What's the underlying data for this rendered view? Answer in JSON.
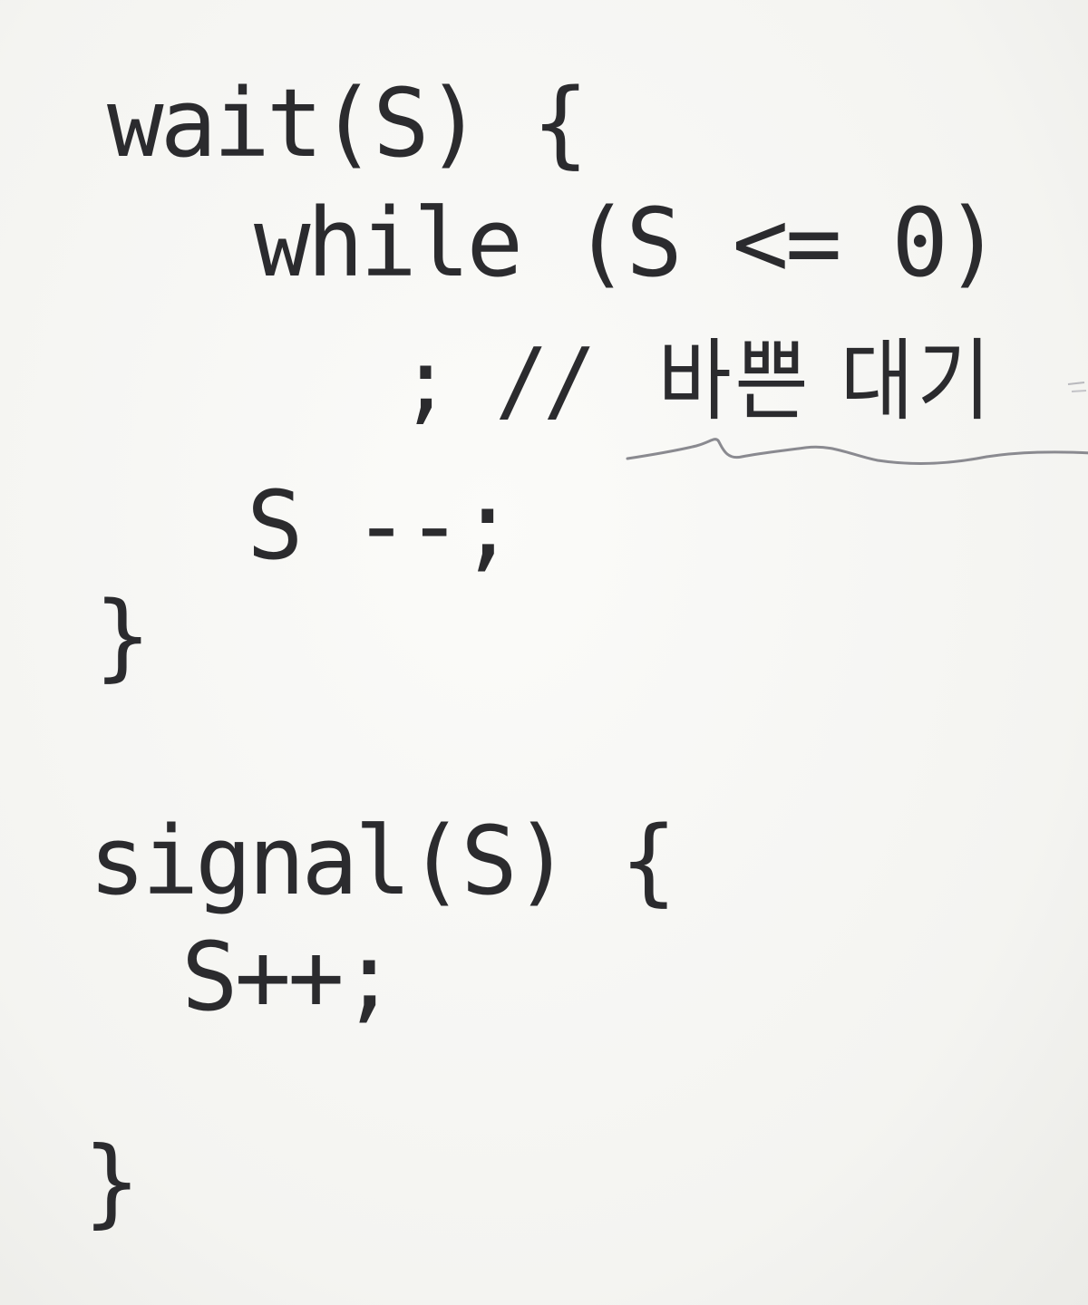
{
  "code": {
    "wait_header": "wait(S) {",
    "while_line": "while (S <= 0)",
    "busy_wait_prefix": "; // ",
    "busy_wait_comment": "바쁜 대기",
    "decrement_line": "S --;",
    "wait_close": "}",
    "signal_header": "signal(S) {",
    "increment_line": "S++;",
    "signal_close": "}"
  },
  "annotations": {
    "underline_color": "#8a8a90",
    "ink_color": "#2b2b2e"
  }
}
